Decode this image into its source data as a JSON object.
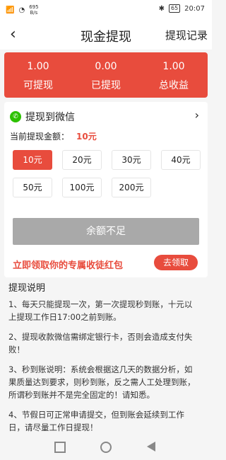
{
  "status_bar": {
    "speed_value": "695",
    "speed_unit": "B/s",
    "battery": "65",
    "time": "20:07"
  },
  "nav": {
    "title": "现金提现",
    "history_label": "提现记录"
  },
  "summary": [
    {
      "value": "1.00",
      "label": "可提现"
    },
    {
      "value": "0.00",
      "label": "已提现"
    },
    {
      "value": "1.00",
      "label": "总收益"
    }
  ],
  "withdraw": {
    "method_label": "提现到微信",
    "amount_label": "当前提现金额：",
    "amount_value": "10元",
    "options": [
      "10元",
      "20元",
      "30元",
      "40元",
      "50元",
      "100元",
      "200元"
    ],
    "selected_index": 0,
    "balance_button_label": "余额不足",
    "promo_text": "立即领取你的专属收徒红包",
    "go_button_label": "去领取"
  },
  "instructions": {
    "title": "提现说明",
    "items": [
      "1、每天只能提现一次，第一次提现秒到账，十元以上提现工作日17:00之前到账。",
      "2、提现收款微信需绑定银行卡，否则会造成支付失败！",
      "3、秒到账说明：系统会根据这几天的数据分析，如果质量达到要求，则秒到账，反之需人工处理到账，所谓秒到账并不是完全固定的！请知悉。",
      "4、节假日可正常申请提交，但到账会延续到工作日，请尽量工作日提现！"
    ]
  },
  "colors": {
    "accent": "#e84c3d",
    "wechat_green": "#2dc100",
    "disabled_button": "#a9a9a9"
  }
}
